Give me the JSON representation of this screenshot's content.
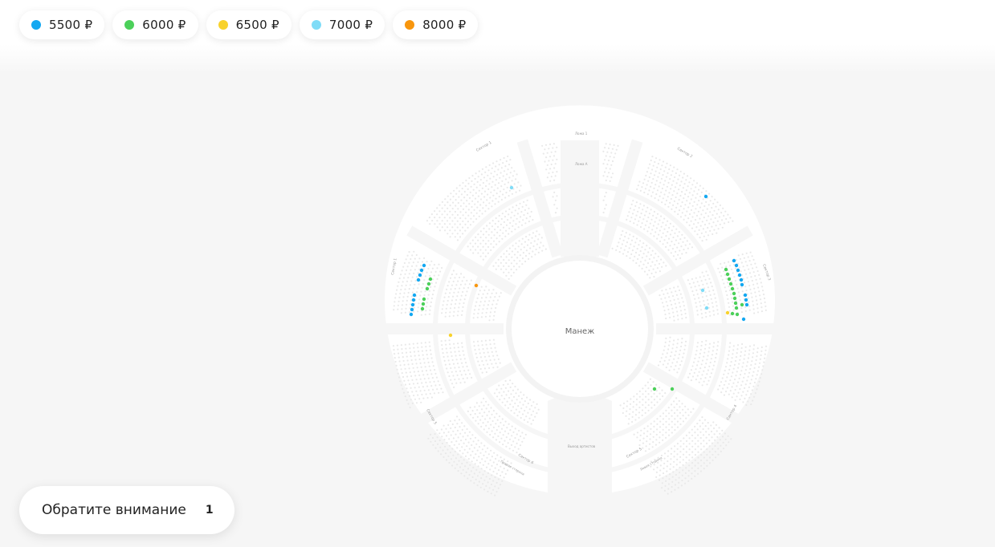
{
  "legend": [
    {
      "label": "5500 ₽",
      "color": "#13a8f1"
    },
    {
      "label": "6000 ₽",
      "color": "#4cd05a"
    },
    {
      "label": "6500 ₽",
      "color": "#f8d22c"
    },
    {
      "label": "7000 ₽",
      "color": "#7fdcf7"
    },
    {
      "label": "8000 ₽",
      "color": "#f8960d"
    }
  ],
  "arena": {
    "center_label": "Манеж",
    "entrance_label": "Выход артистов"
  },
  "sections": [
    "Сектор 1",
    "Ложа 1",
    "Сектор 2",
    "Сектор 3",
    "Сектор 4",
    "Сектор 5",
    "Сектор 6",
    "Правая сторона",
    "Левая сторона",
    "Ложа А"
  ],
  "notice": {
    "label": "Обратите внимание",
    "count": "1"
  }
}
